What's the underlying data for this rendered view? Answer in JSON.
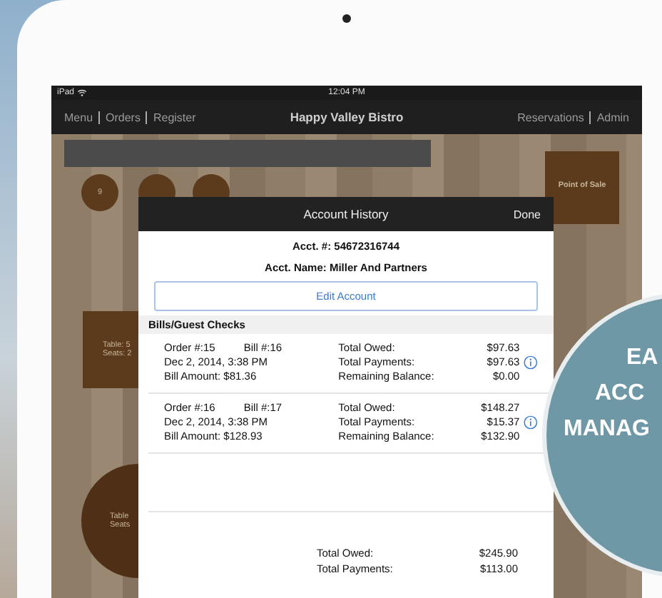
{
  "status_bar": {
    "device": "iPad",
    "time": "12:04 PM"
  },
  "nav": {
    "left": [
      {
        "label": "Menu"
      },
      {
        "label": "Orders"
      },
      {
        "label": "Register"
      }
    ],
    "title": "Happy Valley Bistro",
    "right": [
      {
        "label": "Reservations"
      },
      {
        "label": "Admin"
      }
    ]
  },
  "floor": {
    "tables": [
      {
        "kind": "round",
        "lines": [
          "9"
        ]
      },
      {
        "kind": "round"
      },
      {
        "kind": "round"
      },
      {
        "kind": "square",
        "lines": [
          "Table: 5",
          "Seats: 2"
        ]
      },
      {
        "kind": "large-round",
        "lines": [
          "Table",
          "Seats"
        ]
      }
    ],
    "point_of_sale": "Point of Sale"
  },
  "modal": {
    "title": "Account History",
    "done": "Done",
    "account_number": "Acct. #: 54672316744",
    "account_name": "Acct. Name: Miller And Partners",
    "edit_button": "Edit Account",
    "section": "Bills/Guest Checks",
    "bills": [
      {
        "order": "Order #:15",
        "bill": "Bill #:16",
        "date": "Dec 2, 2014, 3:38 PM",
        "amount": "Bill Amount: $81.36",
        "totals": [
          {
            "label": "Total Owed:",
            "value": "$97.63"
          },
          {
            "label": "Total Payments:",
            "value": "$97.63"
          },
          {
            "label": "Remaining Balance:",
            "value": "$0.00"
          }
        ]
      },
      {
        "order": "Order #:16",
        "bill": "Bill #:17",
        "date": "Dec 2, 2014, 3:38 PM",
        "amount": "Bill Amount: $128.93",
        "totals": [
          {
            "label": "Total Owed:",
            "value": "$148.27"
          },
          {
            "label": "Total Payments:",
            "value": "$15.37"
          },
          {
            "label": "Remaining Balance:",
            "value": "$132.90"
          }
        ]
      }
    ],
    "summary": [
      {
        "label": "Total Owed:",
        "value": "$245.90"
      },
      {
        "label": "Total Payments:",
        "value": "$113.00"
      }
    ]
  },
  "badge": {
    "lines": [
      "EA",
      "ACC",
      "MANAG"
    ]
  }
}
